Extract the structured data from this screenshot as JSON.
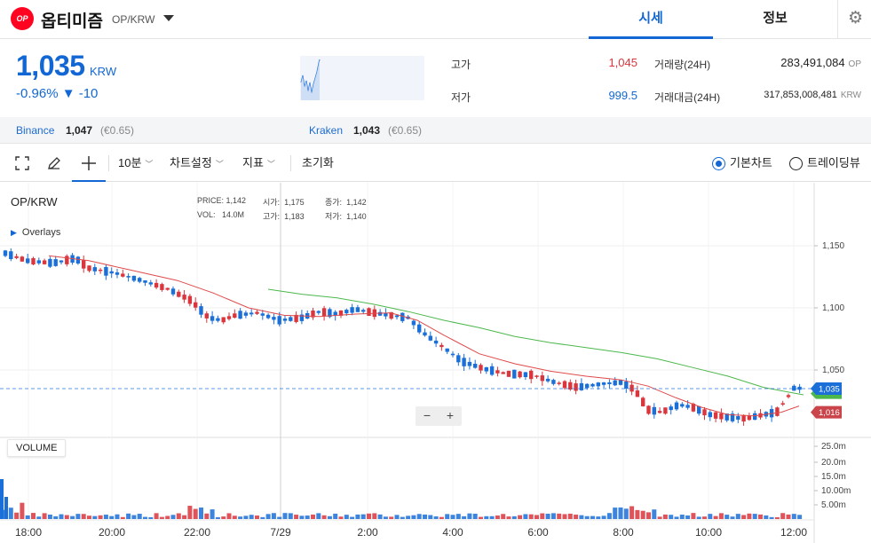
{
  "header": {
    "logo_text": "OP",
    "coin_name": "옵티미즘",
    "pair": "OP/KRW",
    "tabs": {
      "price": "시세",
      "info": "정보"
    },
    "settings_icon": "gear-icon"
  },
  "summary": {
    "price": "1,035",
    "unit": "KRW",
    "change": "-0.96% ▼ -10",
    "high_label": "고가",
    "high_value": "1,045",
    "low_label": "저가",
    "low_value": "999.5",
    "volume_label": "거래량(24H)",
    "volume_value": "283,491,084",
    "volume_unit": "OP",
    "turnover_label": "거래대금(24H)",
    "turnover_value": "317,853,008,481",
    "turnover_unit": "KRW"
  },
  "exchanges": [
    {
      "name": "Binance",
      "price": "1,047",
      "diff": "(€0.65)"
    },
    {
      "name": "Kraken",
      "price": "1,043",
      "diff": "(€0.65)"
    }
  ],
  "toolbar": {
    "interval": "10분",
    "chart_settings": "차트설정",
    "indicators": "지표",
    "reset": "초기화",
    "basic_chart": "기본차트",
    "tradingview": "트레이딩뷰"
  },
  "chart": {
    "symbol": "OP/KRW",
    "overlays": "Overlays",
    "legend": {
      "price_lbl": "PRICE:",
      "price": "1,142",
      "open_lbl": "시가:",
      "open": "1,175",
      "close_lbl": "종가:",
      "close": "1,142",
      "vol_lbl": "VOL:",
      "vol": "14.0M",
      "high_lbl": "고가:",
      "high": "1,183",
      "low_lbl": "저가:",
      "low": "1,140"
    },
    "volume_label": "VOLUME",
    "zoom_out": "−",
    "zoom_in": "+",
    "colors": {
      "up": "#d9363e",
      "down": "#1a6fd8",
      "ma_short": "#e04a4a",
      "ma_long": "#4cb84c",
      "current": "#1a6fd8"
    }
  },
  "chart_data": {
    "type": "candlestick",
    "price_ticks": [
      1150,
      1100,
      1050
    ],
    "price_tick_labels": [
      "1,150",
      "1,100",
      "1,050"
    ],
    "volume_ticks": [
      "25.0m",
      "20.0m",
      "15.0m",
      "10.00m",
      "5.00m"
    ],
    "time_labels": [
      "18:00",
      "20:00",
      "22:00",
      "7/29",
      "2:00",
      "4:00",
      "6:00",
      "8:00",
      "10:00",
      "12:00"
    ],
    "current_price_tag": "1,035",
    "ma_tag": "1,016"
  }
}
